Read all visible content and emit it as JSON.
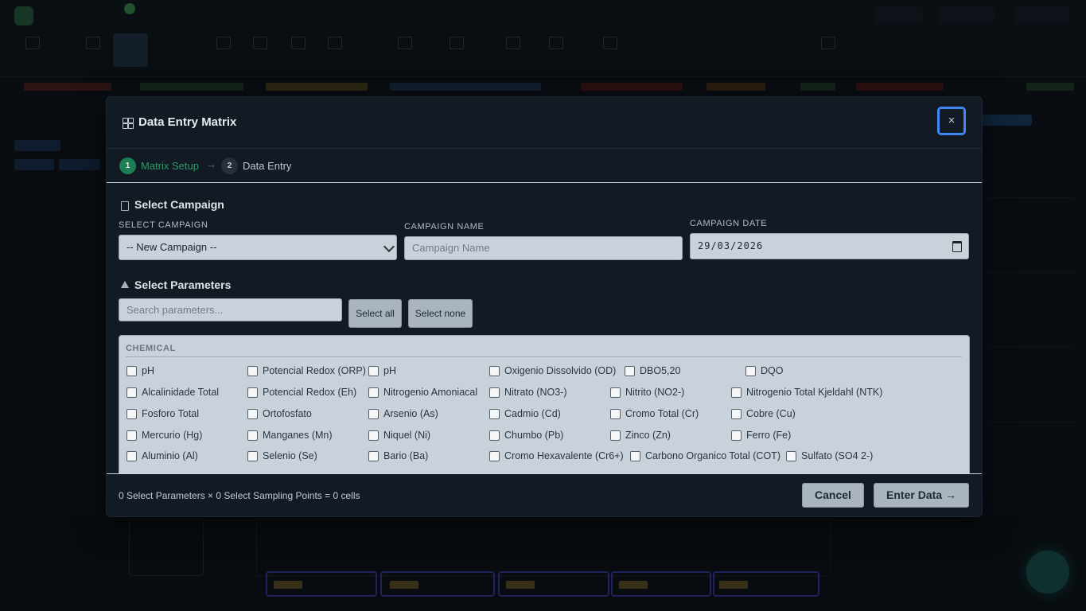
{
  "modal": {
    "title": "Data Entry Matrix",
    "close_label": "×",
    "steps": [
      {
        "number": "1",
        "label": "Matrix Setup"
      },
      {
        "number": "2",
        "label": "Data Entry"
      }
    ],
    "step_separator": "→",
    "campaign_section": {
      "title": "Select Campaign",
      "select_label": "SELECT CAMPAIGN",
      "select_value": "-- New Campaign --",
      "name_label": "CAMPAIGN NAME",
      "name_placeholder": "Campaign Name",
      "date_label": "CAMPAIGN DATE",
      "date_value": "29/03/2026"
    },
    "parameters_section": {
      "title": "Select Parameters",
      "search_placeholder": "Search parameters...",
      "select_all": "Select all",
      "select_none": "Select none",
      "category": "CHEMICAL",
      "rows": [
        [
          "pH",
          "Potencial Redox (ORP)",
          "pH",
          "Oxigenio Dissolvido (OD)",
          "DBO5,20",
          "DQO"
        ],
        [
          "Alcalinidade Total",
          "Potencial Redox (Eh)",
          "Nitrogenio Amoniacal",
          "Nitrato (NO3-)",
          "Nitrito (NO2-)",
          "Nitrogenio Total Kjeldahl (NTK)"
        ],
        [
          "Fosforo Total",
          "Ortofosfato",
          "Arsenio (As)",
          "Cadmio (Cd)",
          "Cromo Total (Cr)",
          "Cobre (Cu)"
        ],
        [
          "Mercurio (Hg)",
          "Manganes (Mn)",
          "Niquel (Ni)",
          "Chumbo (Pb)",
          "Zinco (Zn)",
          "Ferro (Fe)"
        ],
        [
          "Aluminio (Al)",
          "Selenio (Se)",
          "Bario (Ba)",
          "Cromo Hexavalente (Cr6+)",
          "Carbono Organico Total (COT)",
          "Sulfato (SO4 2-)"
        ]
      ]
    },
    "footer": {
      "summary": "0 Select Parameters × 0 Select Sampling Points = 0 cells",
      "cancel": "Cancel",
      "enter": "Enter Data →"
    }
  },
  "colors": {
    "accent_step": "#2f9a6a",
    "focus_ring": "#3f86f0",
    "modal_bg": "#121a24"
  }
}
